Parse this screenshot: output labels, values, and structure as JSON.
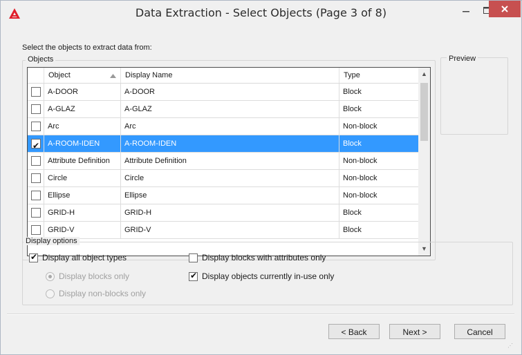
{
  "window": {
    "title": "Data Extraction - Select Objects (Page 3 of 8)",
    "icons": {
      "app": "autocad-logo-icon",
      "minimize": "minimize-icon",
      "maximize": "maximize-icon",
      "close": "close-icon"
    }
  },
  "instruction": "Select the objects to extract data from:",
  "objects_group": {
    "label": "Objects",
    "columns": {
      "object": "Object",
      "display_name": "Display Name",
      "type": "Type"
    },
    "sort_icon": "sort-ascending-icon",
    "rows": [
      {
        "checked": false,
        "object": "A-DOOR",
        "display_name": "A-DOOR",
        "type": "Block",
        "selected": false
      },
      {
        "checked": false,
        "object": "A-GLAZ",
        "display_name": "A-GLAZ",
        "type": "Block",
        "selected": false
      },
      {
        "checked": false,
        "object": "Arc",
        "display_name": "Arc",
        "type": "Non-block",
        "selected": false
      },
      {
        "checked": true,
        "object": "A-ROOM-IDEN",
        "display_name": "A-ROOM-IDEN",
        "type": "Block",
        "selected": true
      },
      {
        "checked": false,
        "object": "Attribute Definition",
        "display_name": "Attribute Definition",
        "type": "Non-block",
        "selected": false
      },
      {
        "checked": false,
        "object": "Circle",
        "display_name": "Circle",
        "type": "Non-block",
        "selected": false
      },
      {
        "checked": false,
        "object": "Ellipse",
        "display_name": "Ellipse",
        "type": "Non-block",
        "selected": false
      },
      {
        "checked": false,
        "object": "GRID-H",
        "display_name": "GRID-H",
        "type": "Block",
        "selected": false
      },
      {
        "checked": false,
        "object": "GRID-V",
        "display_name": "GRID-V",
        "type": "Block",
        "selected": false
      }
    ]
  },
  "preview": {
    "label": "Preview"
  },
  "display_options": {
    "label": "Display options",
    "all_types": {
      "label": "Display all object types",
      "checked": true
    },
    "blocks_only": {
      "label": "Display blocks only",
      "selected": true,
      "enabled": false
    },
    "nonblocks_only": {
      "label": "Display non-blocks only",
      "selected": false,
      "enabled": false
    },
    "attributes_only": {
      "label": "Display blocks with attributes only",
      "checked": false
    },
    "in_use_only": {
      "label": "Display objects currently in-use only",
      "checked": true
    }
  },
  "buttons": {
    "back": "< Back",
    "next": "Next >",
    "cancel": "Cancel"
  },
  "colors": {
    "selection": "#3399ff",
    "close": "#c75050",
    "accent": "#e01e2a"
  }
}
